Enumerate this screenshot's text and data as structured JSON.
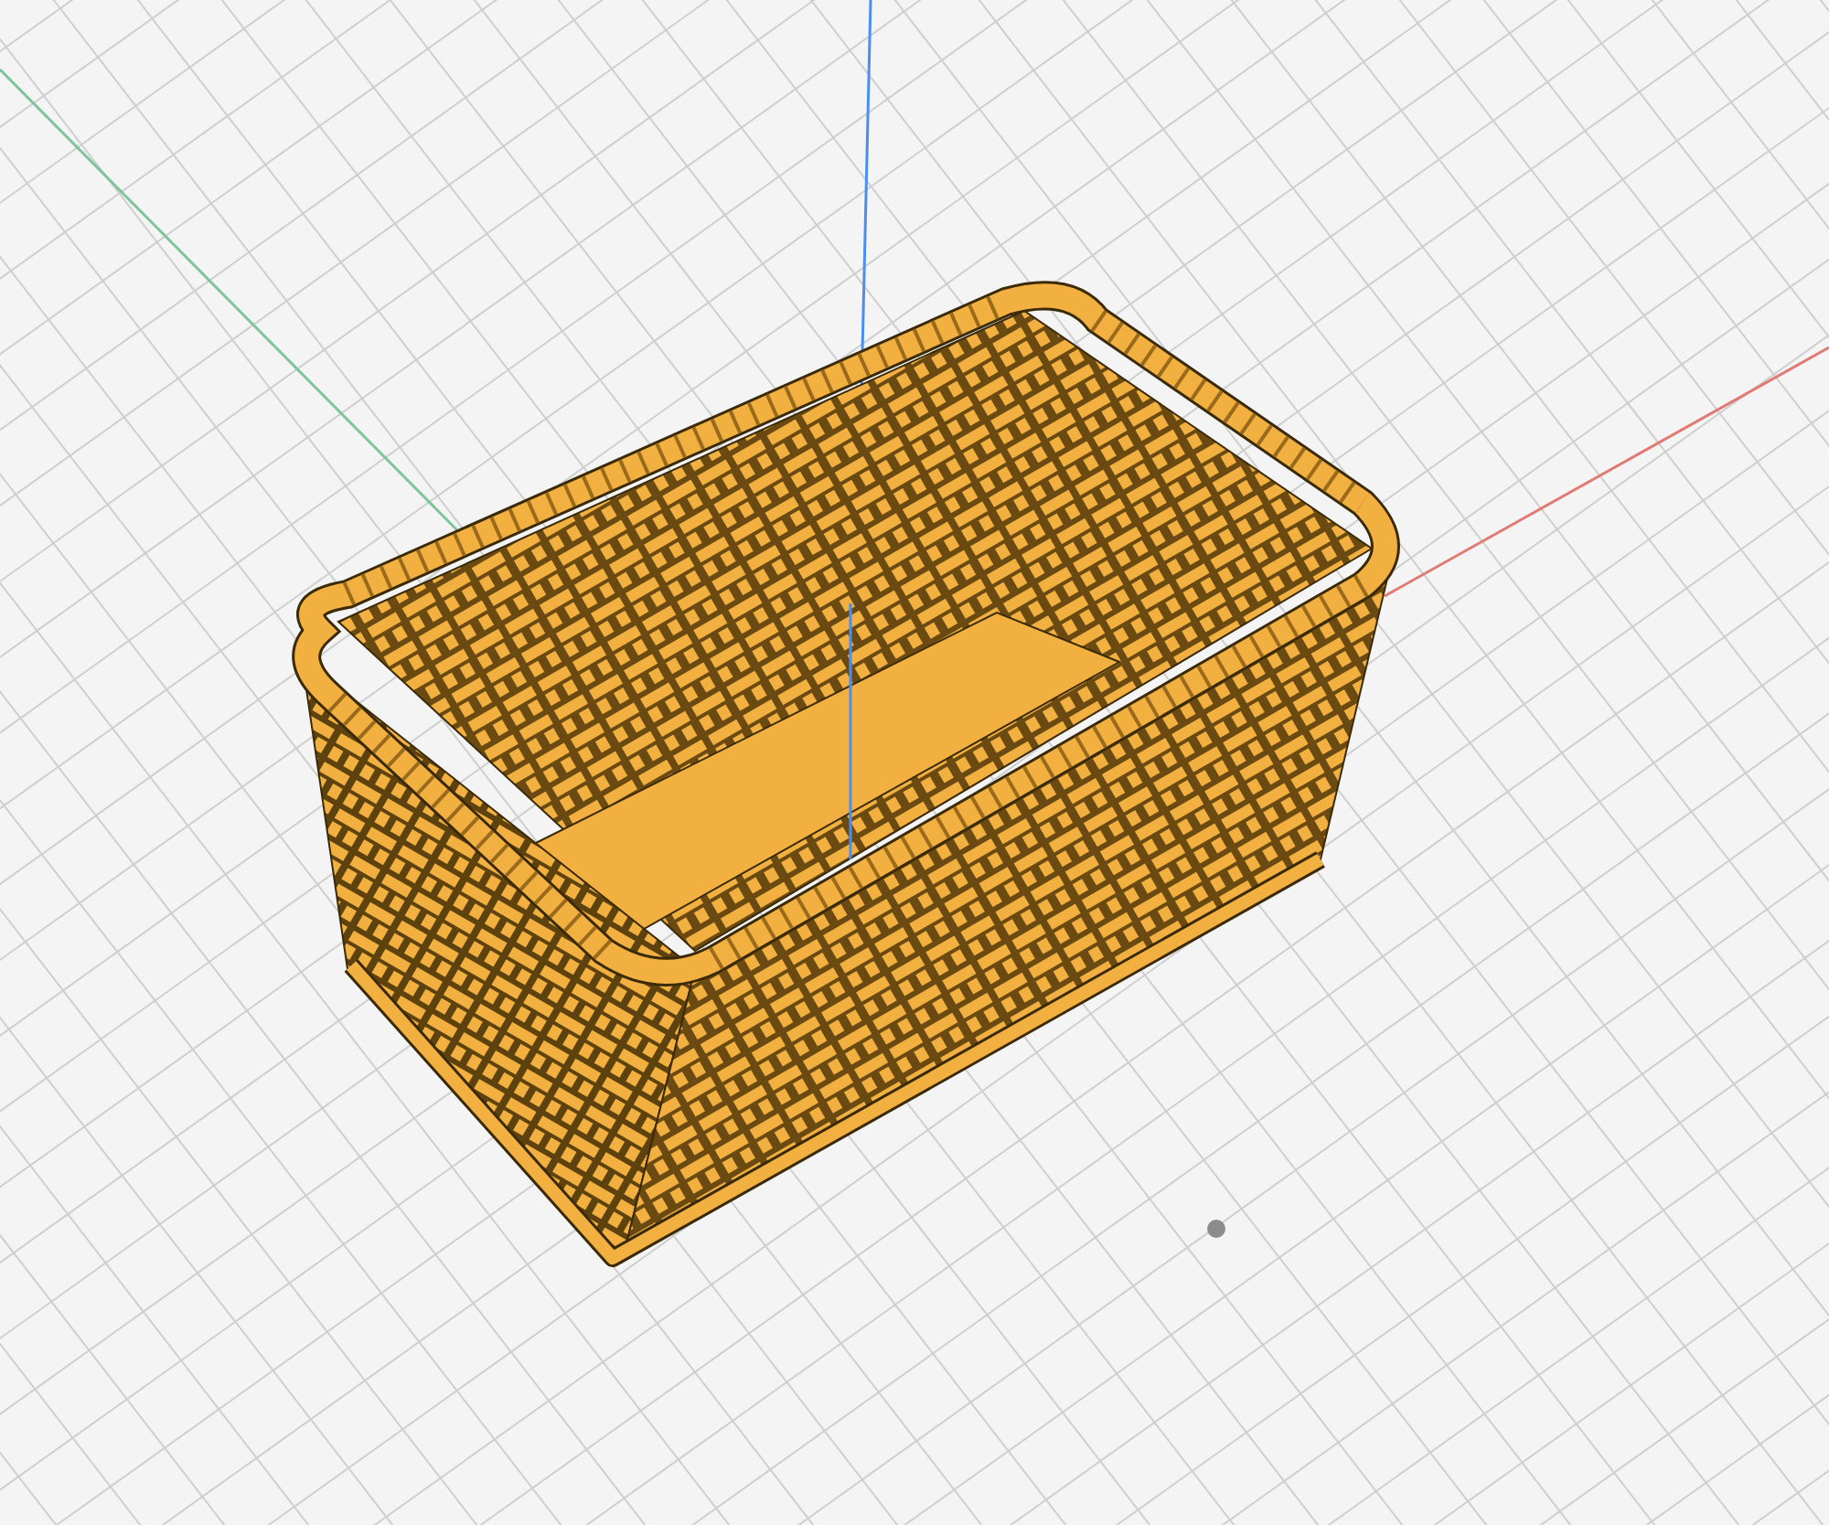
{
  "viewport": {
    "axes": [
      {
        "kind": "vertical",
        "color": "#4a8ff0"
      },
      {
        "kind": "left",
        "color": "#7fc49a"
      },
      {
        "kind": "right",
        "color": "#e07a72"
      }
    ],
    "model": {
      "color": "#f2b040"
    },
    "marker": {
      "color": "#8c8c8c"
    }
  }
}
